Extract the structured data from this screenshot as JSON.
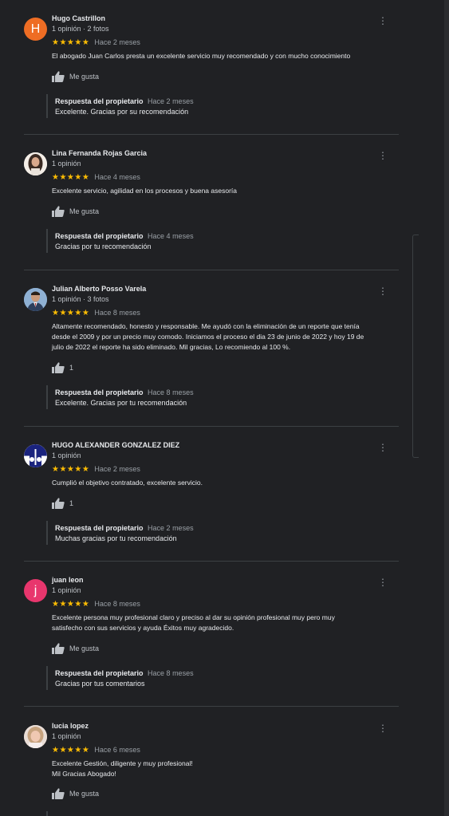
{
  "reviews": [
    {
      "name": "Hugo Castrillon",
      "meta": "1 opinión · 2 fotos",
      "stars": "★★★★★",
      "date": "Hace 2 meses",
      "text": "El abogado Juan Carlos presta un excelente servicio muy recomendado y con mucho conocimiento",
      "like": "Me gusta",
      "reply_owner": "Respuesta del propietario",
      "reply_date": "Hace 2 meses",
      "reply_text": "Excelente. Gracias por su recomendación",
      "avatar_letter": "H",
      "avatar_color": "#ee6d24"
    },
    {
      "name": "Lina Fernanda Rojas Garcia",
      "meta": "1 opinión",
      "stars": "★★★★★",
      "date": "Hace 4 meses",
      "text": "Excelente servicio, agilidad en los procesos y buena asesoría",
      "like": "Me gusta",
      "reply_owner": "Respuesta del propietario",
      "reply_date": "Hace 4 meses",
      "reply_text": "Gracias por tu recomendación"
    },
    {
      "name": "Julian Alberto Posso Varela",
      "meta": "1 opinión · 3 fotos",
      "stars": "★★★★★",
      "date": "Hace 8 meses",
      "text": "Altamente recomendado, honesto y responsable. Me ayudó con la eliminación de un reporte que tenía\ndesde el 2009 y por un precio muy comodo. Iniciamos el proceso el dia 23 de junio de 2022 y hoy  19 de\njulio de 2022 el reporte ha sido eliminado. Mil gracias, Lo recomiendo al 100 %.",
      "like": "1",
      "reply_owner": "Respuesta del propietario",
      "reply_date": "Hace 8 meses",
      "reply_text": "Excelente. Gracias por tu recomendación"
    },
    {
      "name": "HUGO ALEXANDER GONZALEZ DIEZ",
      "meta": "1 opinión",
      "stars": "★★★★★",
      "date": "Hace 2 meses",
      "text": "Cumplió el objetivo contratado, excelente servicio.",
      "like": "1",
      "reply_owner": "Respuesta del propietario",
      "reply_date": "Hace 2 meses",
      "reply_text": "Muchas gracias por tu recomendación"
    },
    {
      "name": "juan leon",
      "meta": "1 opinión",
      "stars": "★★★★★",
      "date": "Hace 8 meses",
      "text": "Excelente persona muy profesional claro y preciso al dar su opinión profesional muy pero muy\nsatisfecho con sus servicios y ayuda Éxitos muy agradecido.",
      "like": "Me gusta",
      "reply_owner": "Respuesta del propietario",
      "reply_date": "Hace 8 meses",
      "reply_text": "Gracias por tus comentarios",
      "avatar_letter": "j",
      "avatar_color": "#e8366d"
    },
    {
      "name": "lucia lopez",
      "meta": "1 opinión",
      "stars": "★★★★★",
      "date": "Hace 6 meses",
      "text": "Excelente Gestión, diligente y muy profesional!\nMil Gracias Abogado!",
      "like": "Me gusta"
    }
  ],
  "icons": {
    "like": "thumb-up-icon",
    "menu": "more-vert-icon"
  },
  "colors": {
    "background": "#202124",
    "stars": "#fbbc04"
  }
}
